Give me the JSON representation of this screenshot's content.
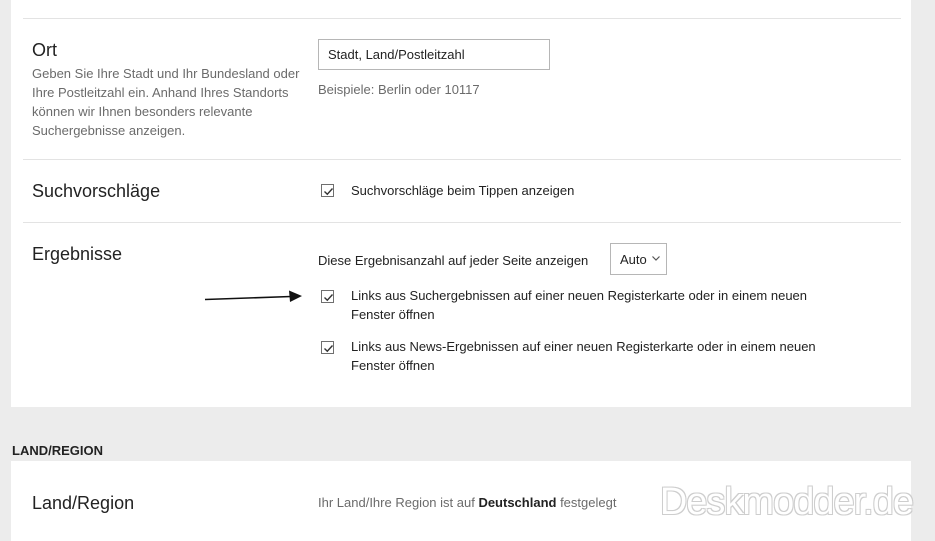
{
  "location": {
    "title": "Ort",
    "description": "Geben Sie Ihre Stadt und Ihr Bundesland oder Ihre Postleitzahl ein. Anhand Ihres Standorts können wir Ihnen besonders relevante Suchergebnisse anzeigen.",
    "input_value": "Stadt, Land/Postleitzahl",
    "hint": "Beispiele: Berlin oder 10117"
  },
  "suggestions": {
    "title": "Suchvorschläge",
    "checkbox_label": "Suchvorschläge beim Tippen anzeigen",
    "checked": true
  },
  "results": {
    "title": "Ergebnisse",
    "count_label": "Diese Ergebnisanzahl auf jeder Seite anzeigen",
    "count_value": "Auto",
    "new_tab_label": "Links aus Suchergebnissen auf einer neuen Registerkarte oder in einem neuen Fenster öffnen",
    "new_tab_checked": true,
    "news_new_tab_label": "Links aus News-Ergebnissen auf einer neuen Registerkarte oder in einem neuen Fenster öffnen",
    "news_new_tab_checked": true
  },
  "region_section": {
    "heading": "LAND/REGION",
    "title": "Land/Region",
    "status_prefix": "Ihr Land/Ihre Region ist auf ",
    "status_country": "Deutschland",
    "status_suffix": " festgelegt"
  },
  "watermark": "Deskmodder.de",
  "colors": {
    "page_bg": "#ececec",
    "card_bg": "#ffffff",
    "divider": "#e3e3e3",
    "muted_text": "#6b6b6b"
  }
}
